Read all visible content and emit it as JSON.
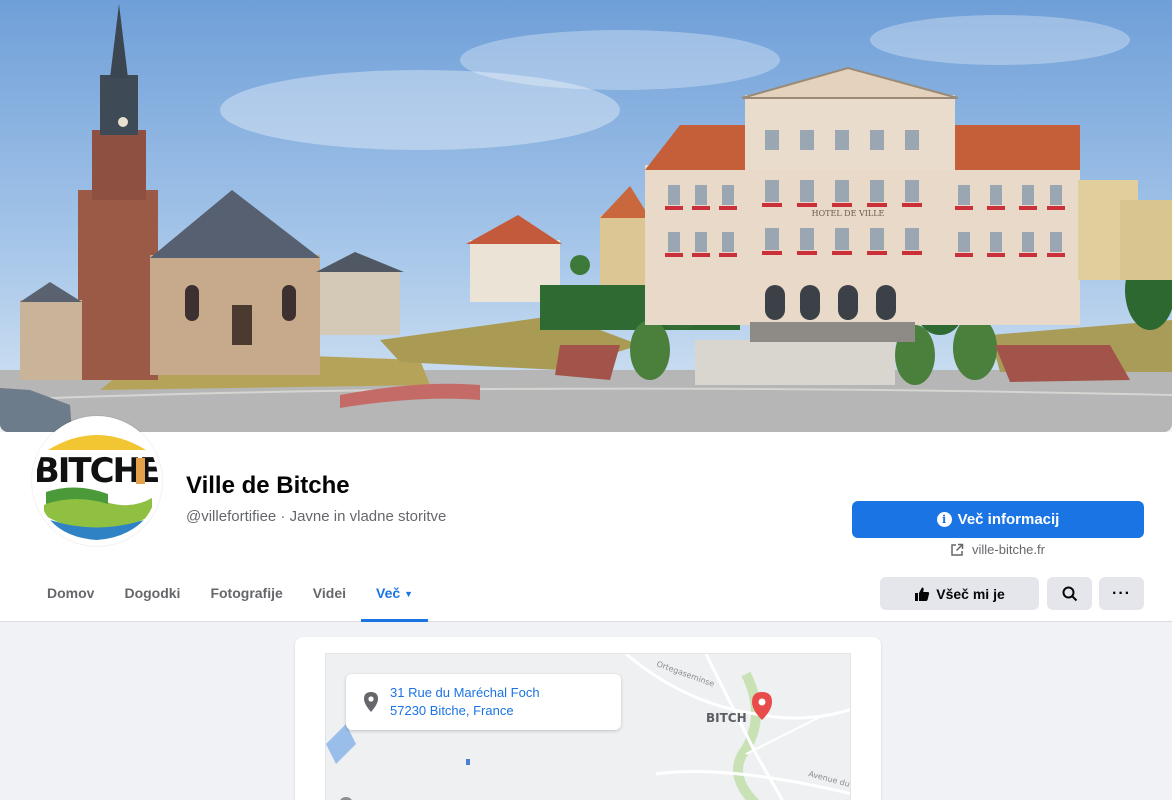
{
  "page": {
    "name": "Ville de Bitche",
    "handle_category": "@villefortifiee · Javne in vladne storitve",
    "logo_text": "BITCHE"
  },
  "actions": {
    "more_info_label": "Več informacij",
    "website": "ville-bitche.fr",
    "like_label": "Všeč mi je"
  },
  "tabs": [
    {
      "label": "Domov",
      "active": false
    },
    {
      "label": "Dogodki",
      "active": false
    },
    {
      "label": "Fotografije",
      "active": false
    },
    {
      "label": "Videi",
      "active": false
    },
    {
      "label": "Več",
      "active": true
    }
  ],
  "map": {
    "address_line1": "31 Rue du Maréchal Foch",
    "address_line2": "57230 Bitche, France",
    "town_label": "BITCH",
    "street_label_1": "Ortegaseminse",
    "street_label_2": "Avenue du"
  },
  "cover": {
    "building_sign": "HOTEL DE VILLE"
  },
  "icons": {
    "info": "info-icon",
    "external_link": "external-link-icon",
    "thumbs_up": "thumbs-up-icon",
    "search": "search-icon",
    "more": "more-icon",
    "location_pin": "location-pin-icon",
    "map_marker": "map-marker-icon"
  },
  "colors": {
    "accent": "#1b74e4",
    "marker": "#e94a4a"
  }
}
